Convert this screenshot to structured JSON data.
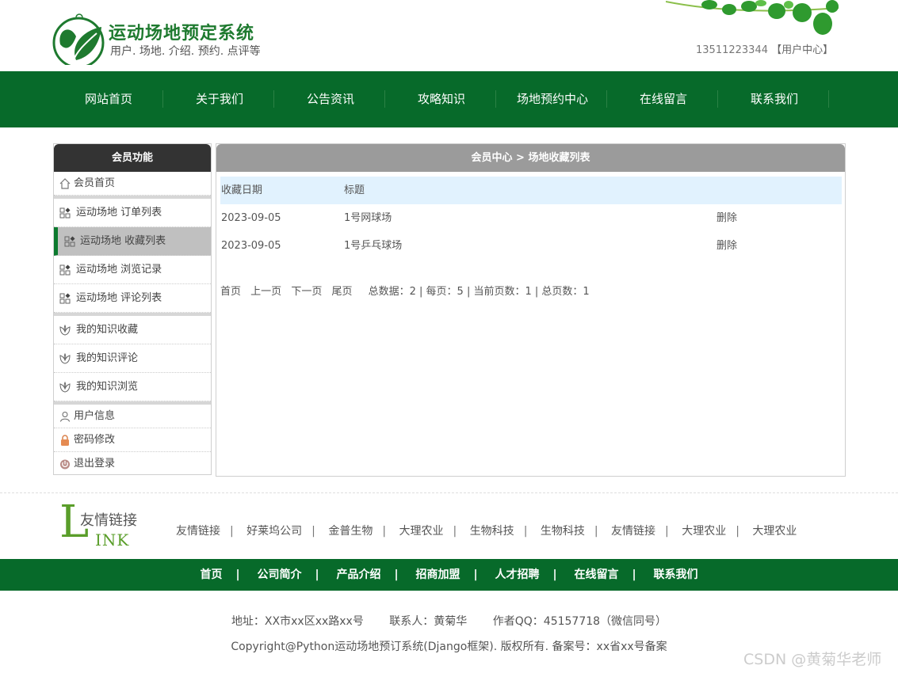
{
  "header": {
    "title": "运动场地预定系统",
    "subtitle": "用户. 场地. 介绍. 预约. 点评等",
    "phone": "13511223344",
    "user_center": "【用户中心】"
  },
  "nav": [
    "网站首页",
    "关于我们",
    "公告资讯",
    "攻略知识",
    "场地预约中心",
    "在线留言",
    "联系我们"
  ],
  "sidebar": {
    "title": "会员功能",
    "home": "会员首页",
    "venue_items": [
      "运动场地 订单列表",
      "运动场地 收藏列表",
      "运动场地 浏览记录",
      "运动场地 评论列表"
    ],
    "knowledge_items": [
      "我的知识收藏",
      "我的知识评论",
      "我的知识浏览"
    ],
    "account_items": [
      "用户信息",
      "密码修改",
      "退出登录"
    ]
  },
  "main": {
    "breadcrumb": "会员中心 > 场地收藏列表",
    "columns": [
      "收藏日期",
      "标题"
    ],
    "rows": [
      {
        "date": "2023-09-05",
        "title": "1号网球场",
        "action": "删除"
      },
      {
        "date": "2023-09-05",
        "title": "1号乒乓球场",
        "action": "删除"
      }
    ],
    "pager": {
      "first": "首页",
      "prev": "上一页",
      "next": "下一页",
      "last": "尾页",
      "info": "总数据：2 | 每页：5 | 当前页数：1 | 总页数：1"
    }
  },
  "friend_links": {
    "logo_cn": "友情链接",
    "logo_en": "INK",
    "logo_letter": "L",
    "items": [
      "友情链接",
      "好莱坞公司",
      "金普生物",
      "大理农业",
      "生物科技",
      "生物科技",
      "友情链接",
      "大理农业",
      "大理农业"
    ]
  },
  "footer_nav": [
    "首页",
    "公司简介",
    "产品介绍",
    "招商加盟",
    "人才招聘",
    "在线留言",
    "联系我们"
  ],
  "footer": {
    "address": "地址：XX市xx区xx路xx号",
    "contact": "联系人：黄菊华",
    "qq": "作者QQ：45157718（微信同号）",
    "copyright": "Copyright@Python运动场地预订系统(Django框架). 版权所有. 备案号：xx省xx号备案"
  },
  "watermark": "CSDN @黄菊华老师",
  "colors": {
    "brand_green": "#076a2a",
    "table_head": "#e1f2fe",
    "sidebar_head": "#333333",
    "main_head": "#9b9b9b"
  }
}
